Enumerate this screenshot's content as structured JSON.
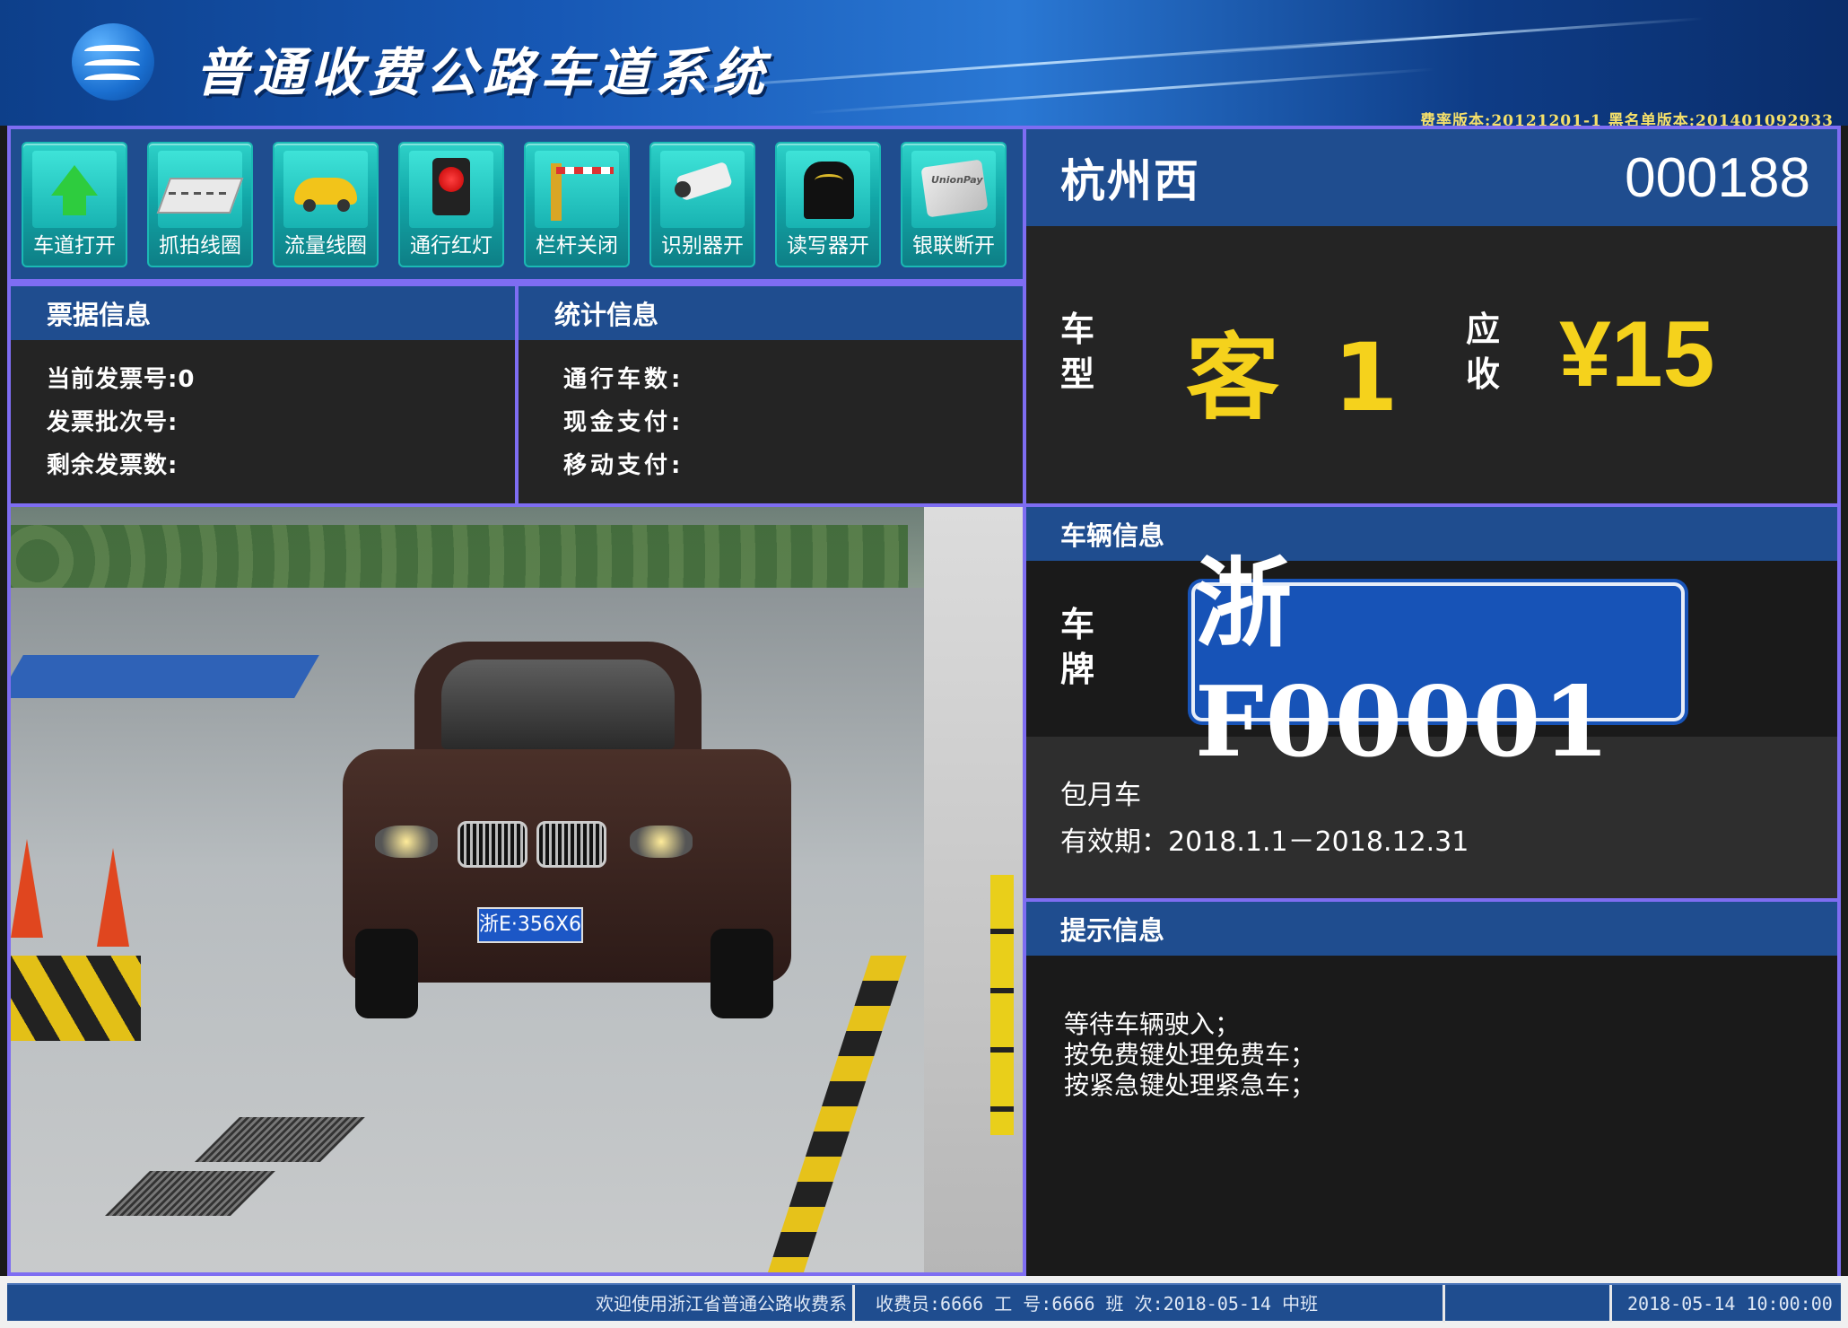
{
  "header": {
    "title": "普通收费公路车道系统",
    "version_line": "费率版本:20121201-1  黑名单版本:201401092933"
  },
  "toolbar": {
    "buttons": [
      {
        "label": "车道打开",
        "icon": "lane-open-arrow-icon"
      },
      {
        "label": "抓拍线圈",
        "icon": "capture-coil-icon"
      },
      {
        "label": "流量线圈",
        "icon": "traffic-coil-car-icon"
      },
      {
        "label": "通行红灯",
        "icon": "red-light-icon"
      },
      {
        "label": "栏杆关闭",
        "icon": "barrier-gate-icon"
      },
      {
        "label": "识别器开",
        "icon": "recognition-camera-icon"
      },
      {
        "label": "读写器开",
        "icon": "card-reader-icon"
      },
      {
        "label": "银联断开",
        "icon": "unionpay-card-icon"
      }
    ]
  },
  "ticket": {
    "title": "票据信息",
    "current_invoice": "当前发票号:0",
    "batch": "发票批次号:",
    "remaining": "剩余发票数:"
  },
  "stats": {
    "title": "统计信息",
    "vehicles": "通行车数:",
    "cash": "现金支付:",
    "mobile": "移动支付:"
  },
  "camera": {
    "plate_in_image": "浙E·356X6"
  },
  "station": {
    "name": "杭州西",
    "code": "000188",
    "type_label": "车型",
    "type_value": "客 1",
    "fee_label": "应收",
    "fee_value": "¥15"
  },
  "vehicle": {
    "title": "车辆信息",
    "plate_label": "车牌",
    "plate": "浙F00001",
    "monthly": "包月车",
    "validity": "有效期：2018.1.1－2018.12.31"
  },
  "hints": {
    "title": "提示信息",
    "lines": [
      "等待车辆驶入；",
      "按免费键处理免费车；",
      "按紧急键处理紧急车；"
    ]
  },
  "statusbar": {
    "welcome": "欢迎使用浙江省普通公路收费系",
    "operator": "收费员:6666  工 号:6666  班 次:2018-05-14  中班",
    "empty": "",
    "datetime": "2018-05-14 10:00:00"
  },
  "colors": {
    "panel_blue": "#1f4d8f",
    "frame_purple": "#7e6df2",
    "value_yellow": "#f5d21c",
    "button_teal": "#12a7a8"
  }
}
